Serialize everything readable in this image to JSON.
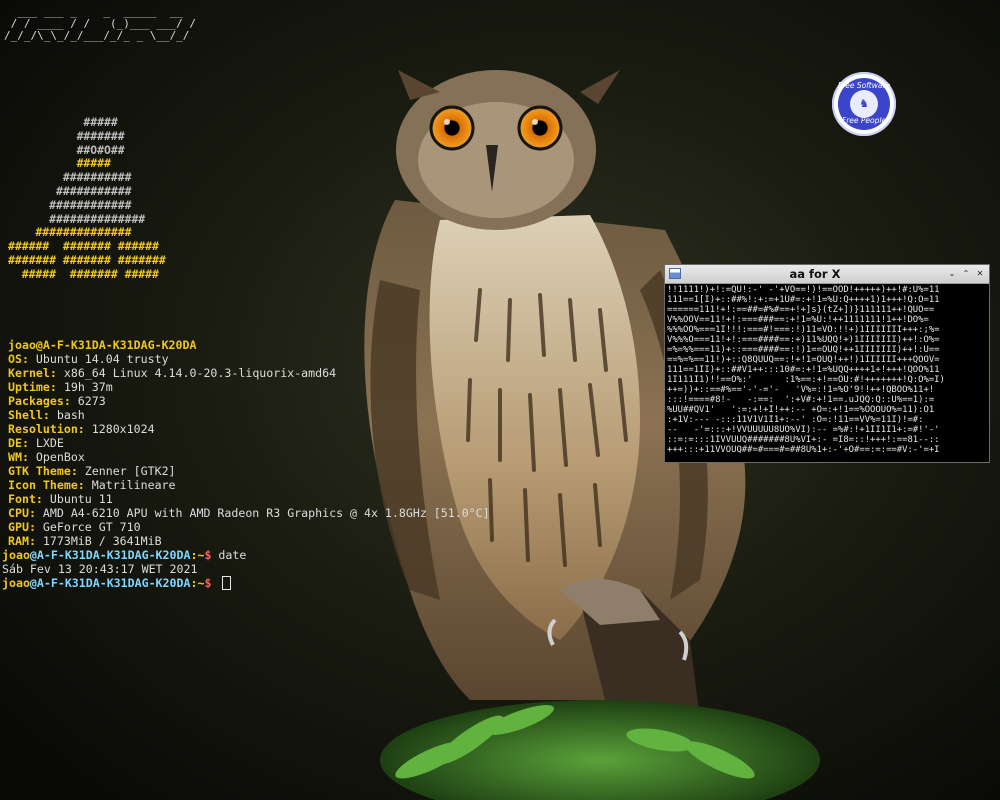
{
  "ascii_title": [
    "  ___ ___ _    _  _____  __",
    " / / ____ / /   (_)___ ___/ /",
    "/_/_/\\_\\_/_/___/_/_ _ \\__/_/"
  ],
  "distro_logo": [
    {
      "text": "           #####",
      "color": "#bdbdbd"
    },
    {
      "text": "          #######",
      "color": "#bdbdbd"
    },
    {
      "text": "          ##O#O##",
      "color": "#bdbdbd"
    },
    {
      "text": "          #####",
      "color": "#f0c81c"
    },
    {
      "text": "        ##########",
      "color": "#bdbdbd"
    },
    {
      "text": "       ###########",
      "color": "#bdbdbd"
    },
    {
      "text": "      ############",
      "color": "#bdbdbd"
    },
    {
      "text": "      ##############",
      "color": "#bdbdbd"
    },
    {
      "text": "    ##############",
      "color": "#f0c81c"
    },
    {
      "text": "######  ####### ######",
      "color": "#f0c81c"
    },
    {
      "text": "####### ####### #######",
      "color": "#f0c81c"
    },
    {
      "text": "  #####  ####### #####",
      "color": "#f0c81c"
    }
  ],
  "sysinfo": {
    "user": "joao",
    "at": "@",
    "host": "A-F-K31DA-K31DAG-K20DA",
    "rows": [
      {
        "key": "OS:",
        "value": " Ubuntu 14.04 trusty"
      },
      {
        "key": "Kernel:",
        "value": " x86_64 Linux 4.14.0-20.3-liquorix-amd64"
      },
      {
        "key": "Uptime:",
        "value": " 19h 37m"
      },
      {
        "key": "Packages:",
        "value": " 6273"
      },
      {
        "key": "Shell:",
        "value": " bash"
      },
      {
        "key": "Resolution:",
        "value": " 1280x1024"
      },
      {
        "key": "DE:",
        "value": " LXDE"
      },
      {
        "key": "WM:",
        "value": " OpenBox"
      },
      {
        "key": "GTK Theme:",
        "value": " Zenner [GTK2]"
      },
      {
        "key": "Icon Theme:",
        "value": " Matrilineare"
      },
      {
        "key": "Font:",
        "value": " Ubuntu 11"
      },
      {
        "key": "CPU:",
        "value": " AMD A4-6210 APU with AMD Radeon R3 Graphics @ 4x 1.8GHz [51.0°C]"
      },
      {
        "key": "GPU:",
        "value": " GeForce GT 710"
      },
      {
        "key": "RAM:",
        "value": " 1773MiB / 3641MiB"
      }
    ]
  },
  "terminal": {
    "prompt_user": "joao",
    "prompt_host": "@A-F-K31DA-K31DAG-K20DA",
    "prompt_path": ":~",
    "prompt_sign": "$ ",
    "command": "date",
    "output": "Sáb Fev 13 20:43:17 WET 2021"
  },
  "badge": {
    "top_text": "Free Software",
    "bottom_text": "Free People",
    "accent": "#3b45c9"
  },
  "aa_window": {
    "title": "aa for X",
    "controls": [
      "⌄",
      "⌃",
      "✕"
    ],
    "screen_lines": [
      "!!1111!)+!:=QU!:-' -'+VO==!)!==OOD!+++++)++!#:U%=11",
      "111==1[I)+::##%!:+:=+1U#=:+!1=%U:Q++++1)1+++!Q:O=11",
      "======111!+!:==##=#%#==+!+]s}(tZ+])}111111++!QUO==",
      "V%%OOV==11!+!:===###==:+!1=%U:!++1111111!1++!DO%=",
      "%%%OO%===1I!!!:===#!===:!)11=VO:!!+)1IIIIIII+++:;%=",
      "V%%%O===11!+!:===####==:+)11%UQQ!+)1IIIIIII)++!:O%=",
      "=%=%%===11)+::===####==:!)1==OUQ!++1IIIIIII)++!:U==",
      "==%=%==11!)+::Q8QUUQ==:!+!1=OUQ!++!)1IIIIII+++QOOV=",
      "111==1II)+::##V1++:::10#=:+!1=%UQQ++++1+!+++!QOO%11",
      "1I111I1)!!==O%:'      :1%==:+!==OU:#!+++++++!Q:O%=I)",
      "++=))+::==#%=='-'-='-   'V%=:!1=%O'9!!++!QBOO%11+!",
      ":::!====#8!-   -:==:  ':+V#:+!1==.uJQQ:Q::U%==1):=",
      "%UU##QV1'   ':=:+!+I!++:-- +O=:+!1==%OOOUO%=11):O1",
      ":+1V:--- -:::11V1V1I1+:--' :O=:!11==VV%=11I)!=#:",
      "--   -'=:::+!VVUUUUU8UO%VI):-- =%#:!+1II1I1+:=#!'-'",
      "::=:=:::1IVVUUQ#######8U%VI+:- =I8=::!+++!:==81--::",
      "+++:::+11VVOUQ##=#===#=##8U%1+:-'+O#==:=:==#V:-'=+I"
    ]
  }
}
